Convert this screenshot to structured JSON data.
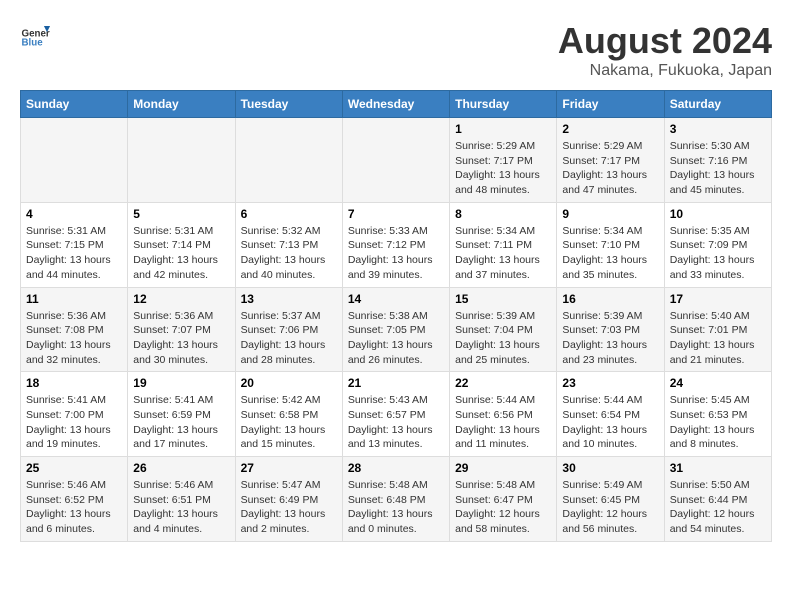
{
  "header": {
    "logo_general": "General",
    "logo_blue": "Blue",
    "title": "August 2024",
    "subtitle": "Nakama, Fukuoka, Japan"
  },
  "columns": [
    "Sunday",
    "Monday",
    "Tuesday",
    "Wednesday",
    "Thursday",
    "Friday",
    "Saturday"
  ],
  "weeks": [
    [
      {
        "day": "",
        "info": ""
      },
      {
        "day": "",
        "info": ""
      },
      {
        "day": "",
        "info": ""
      },
      {
        "day": "",
        "info": ""
      },
      {
        "day": "1",
        "info": "Sunrise: 5:29 AM\nSunset: 7:17 PM\nDaylight: 13 hours\nand 48 minutes."
      },
      {
        "day": "2",
        "info": "Sunrise: 5:29 AM\nSunset: 7:17 PM\nDaylight: 13 hours\nand 47 minutes."
      },
      {
        "day": "3",
        "info": "Sunrise: 5:30 AM\nSunset: 7:16 PM\nDaylight: 13 hours\nand 45 minutes."
      }
    ],
    [
      {
        "day": "4",
        "info": "Sunrise: 5:31 AM\nSunset: 7:15 PM\nDaylight: 13 hours\nand 44 minutes."
      },
      {
        "day": "5",
        "info": "Sunrise: 5:31 AM\nSunset: 7:14 PM\nDaylight: 13 hours\nand 42 minutes."
      },
      {
        "day": "6",
        "info": "Sunrise: 5:32 AM\nSunset: 7:13 PM\nDaylight: 13 hours\nand 40 minutes."
      },
      {
        "day": "7",
        "info": "Sunrise: 5:33 AM\nSunset: 7:12 PM\nDaylight: 13 hours\nand 39 minutes."
      },
      {
        "day": "8",
        "info": "Sunrise: 5:34 AM\nSunset: 7:11 PM\nDaylight: 13 hours\nand 37 minutes."
      },
      {
        "day": "9",
        "info": "Sunrise: 5:34 AM\nSunset: 7:10 PM\nDaylight: 13 hours\nand 35 minutes."
      },
      {
        "day": "10",
        "info": "Sunrise: 5:35 AM\nSunset: 7:09 PM\nDaylight: 13 hours\nand 33 minutes."
      }
    ],
    [
      {
        "day": "11",
        "info": "Sunrise: 5:36 AM\nSunset: 7:08 PM\nDaylight: 13 hours\nand 32 minutes."
      },
      {
        "day": "12",
        "info": "Sunrise: 5:36 AM\nSunset: 7:07 PM\nDaylight: 13 hours\nand 30 minutes."
      },
      {
        "day": "13",
        "info": "Sunrise: 5:37 AM\nSunset: 7:06 PM\nDaylight: 13 hours\nand 28 minutes."
      },
      {
        "day": "14",
        "info": "Sunrise: 5:38 AM\nSunset: 7:05 PM\nDaylight: 13 hours\nand 26 minutes."
      },
      {
        "day": "15",
        "info": "Sunrise: 5:39 AM\nSunset: 7:04 PM\nDaylight: 13 hours\nand 25 minutes."
      },
      {
        "day": "16",
        "info": "Sunrise: 5:39 AM\nSunset: 7:03 PM\nDaylight: 13 hours\nand 23 minutes."
      },
      {
        "day": "17",
        "info": "Sunrise: 5:40 AM\nSunset: 7:01 PM\nDaylight: 13 hours\nand 21 minutes."
      }
    ],
    [
      {
        "day": "18",
        "info": "Sunrise: 5:41 AM\nSunset: 7:00 PM\nDaylight: 13 hours\nand 19 minutes."
      },
      {
        "day": "19",
        "info": "Sunrise: 5:41 AM\nSunset: 6:59 PM\nDaylight: 13 hours\nand 17 minutes."
      },
      {
        "day": "20",
        "info": "Sunrise: 5:42 AM\nSunset: 6:58 PM\nDaylight: 13 hours\nand 15 minutes."
      },
      {
        "day": "21",
        "info": "Sunrise: 5:43 AM\nSunset: 6:57 PM\nDaylight: 13 hours\nand 13 minutes."
      },
      {
        "day": "22",
        "info": "Sunrise: 5:44 AM\nSunset: 6:56 PM\nDaylight: 13 hours\nand 11 minutes."
      },
      {
        "day": "23",
        "info": "Sunrise: 5:44 AM\nSunset: 6:54 PM\nDaylight: 13 hours\nand 10 minutes."
      },
      {
        "day": "24",
        "info": "Sunrise: 5:45 AM\nSunset: 6:53 PM\nDaylight: 13 hours\nand 8 minutes."
      }
    ],
    [
      {
        "day": "25",
        "info": "Sunrise: 5:46 AM\nSunset: 6:52 PM\nDaylight: 13 hours\nand 6 minutes."
      },
      {
        "day": "26",
        "info": "Sunrise: 5:46 AM\nSunset: 6:51 PM\nDaylight: 13 hours\nand 4 minutes."
      },
      {
        "day": "27",
        "info": "Sunrise: 5:47 AM\nSunset: 6:49 PM\nDaylight: 13 hours\nand 2 minutes."
      },
      {
        "day": "28",
        "info": "Sunrise: 5:48 AM\nSunset: 6:48 PM\nDaylight: 13 hours\nand 0 minutes."
      },
      {
        "day": "29",
        "info": "Sunrise: 5:48 AM\nSunset: 6:47 PM\nDaylight: 12 hours\nand 58 minutes."
      },
      {
        "day": "30",
        "info": "Sunrise: 5:49 AM\nSunset: 6:45 PM\nDaylight: 12 hours\nand 56 minutes."
      },
      {
        "day": "31",
        "info": "Sunrise: 5:50 AM\nSunset: 6:44 PM\nDaylight: 12 hours\nand 54 minutes."
      }
    ]
  ]
}
